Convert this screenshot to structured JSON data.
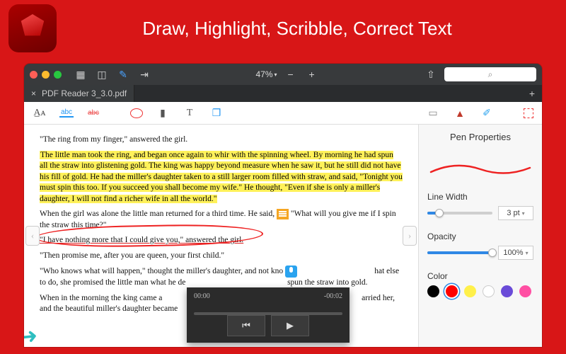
{
  "banner": {
    "title": "Draw, Highlight, Scribble, Correct Text"
  },
  "titlebar": {
    "zoom_value": "47%",
    "search_placeholder": "⌕"
  },
  "tab": {
    "filename": "PDF Reader 3_3.0.pdf"
  },
  "document": {
    "p1": "\"The ring from my finger,\" answered the girl.",
    "p2": "The little man took the ring, and began once again to whir with the spinning wheel. By morning he had spun all the straw into glistening gold. The king was happy beyond measure when he saw it, but he still did not have his fill of gold. He had the miller's daughter taken to a still larger room filled with straw, and said, \"Tonight you must spin this too. If you succeed you shall become my wife.\" He thought, \"Even if she is only a miller's daughter, I will not find a richer wife in all the world.\"",
    "p3a": "When the girl was alone the little man returned for a third time. He said, ",
    "p3b": "\"What will you give me if I spin the straw this time?\"",
    "p4": "\"I have nothing more that I could give you,\" answered the girl.",
    "p5": "\"Then promise me, after you are queen, your first child.\"",
    "p6a": "\"Who knows what will happen,\" thought the miller's daughter, and not kno",
    "p6b": "hat else to do, she promised the little man what he de",
    "p6c": "spun the straw into gold.",
    "p7a": "When in the morning the king came a",
    "p7b": "arried her, and the beautiful miller's daughter became"
  },
  "audio": {
    "elapsed": "00:00",
    "remaining": "-00:02"
  },
  "panel": {
    "title": "Pen Properties",
    "line_width": {
      "label": "Line Width",
      "value": "3 pt",
      "pct": 18
    },
    "opacity": {
      "label": "Opacity",
      "value": "100%",
      "pct": 100
    },
    "color_label": "Color",
    "colors": [
      "#000000",
      "#ff0000",
      "#fff04a",
      "#ffffff",
      "#6a4bd8",
      "#ff4fa3"
    ],
    "selected_color_index": 1
  }
}
